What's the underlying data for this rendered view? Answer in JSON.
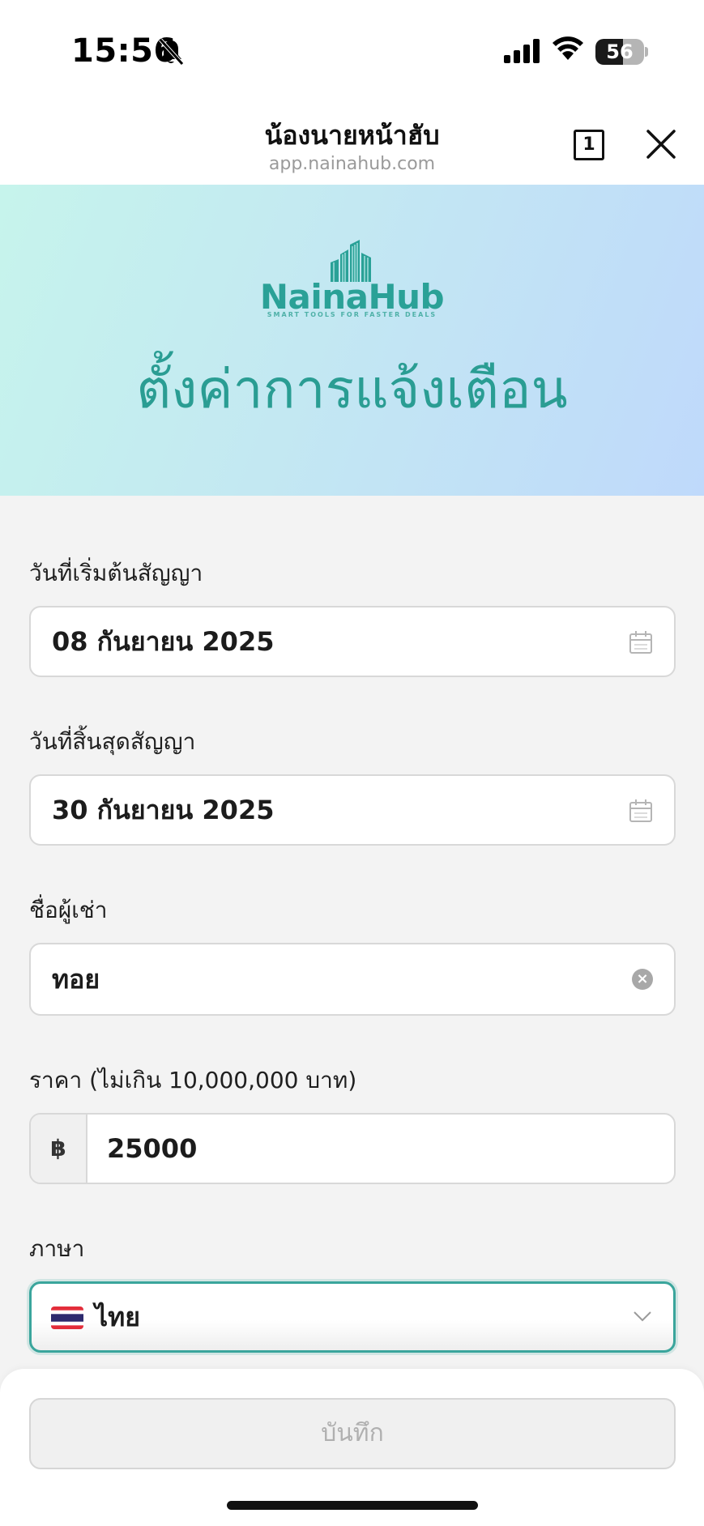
{
  "status_bar": {
    "time": "15:56",
    "battery": "56",
    "battery_level": 0.56
  },
  "browser": {
    "title": "น้องนายหน้าฮับ",
    "url": "app.nainahub.com",
    "tab_count": "1"
  },
  "hero": {
    "logo_text": "NainaHub",
    "logo_tagline": "SMART TOOLS FOR FASTER DEALS",
    "title": "ตั้งค่าการแจ้งเตือน"
  },
  "form": {
    "start_date": {
      "label": "วันที่เริ่มต้นสัญญา",
      "value": "08 กันยายน 2025"
    },
    "end_date": {
      "label": "วันที่สิ้นสุดสัญญา",
      "value": "30 กันยายน 2025"
    },
    "tenant": {
      "label": "ชื่อผู้เช่า",
      "value": "ทอย"
    },
    "price": {
      "label": "ราคา (ไม่เกิน 10,000,000 บาท)",
      "currency": "฿",
      "value": "25000"
    },
    "language": {
      "label": "ภาษา",
      "value": "ไทย"
    }
  },
  "footer": {
    "save_label": "บันทึก"
  },
  "colors": {
    "accent": "#2a9d93",
    "focus_border": "#3aa59c"
  }
}
